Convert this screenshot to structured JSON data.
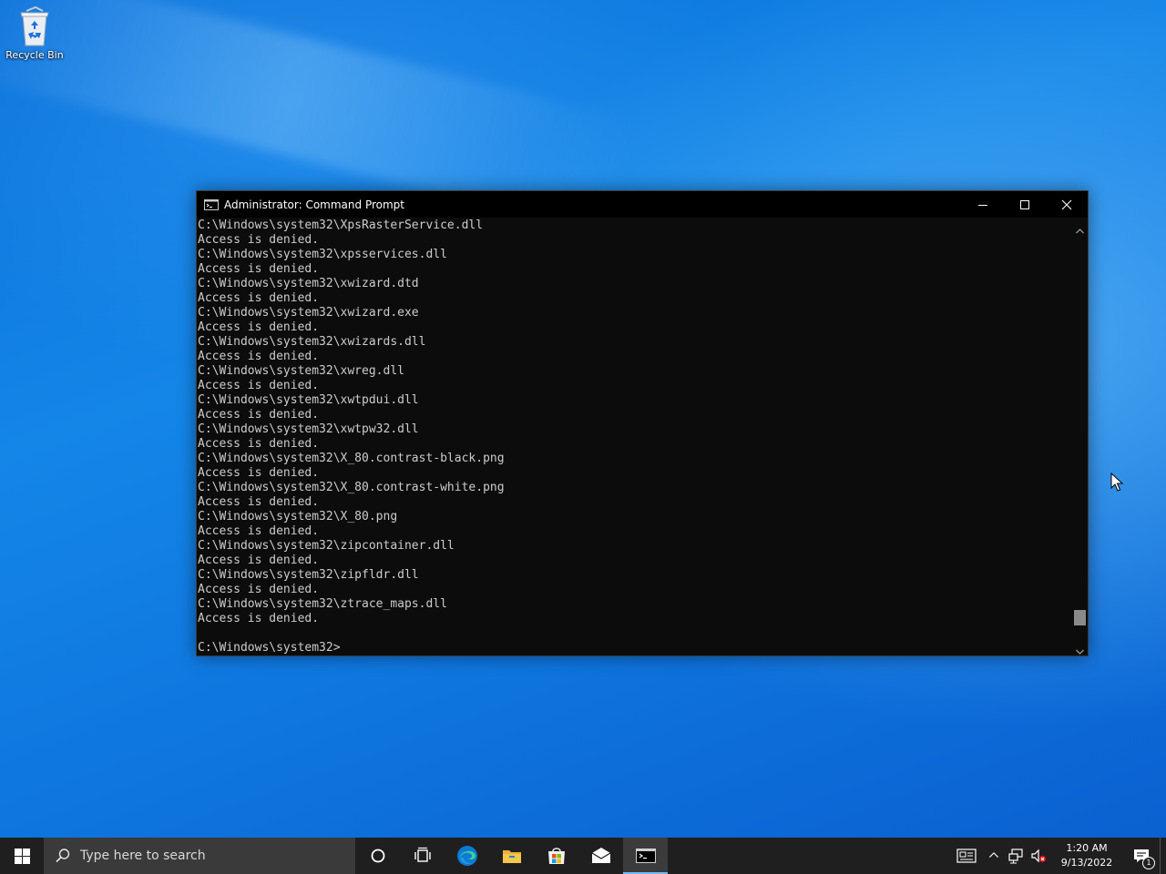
{
  "desktop": {
    "icons": [
      {
        "label": "Recycle Bin",
        "icon": "recycle-bin-icon"
      }
    ]
  },
  "window": {
    "title": "Administrator: Command Prompt",
    "icon": "command-prompt-icon",
    "controls": [
      "minimize-icon",
      "maximize-icon",
      "close-icon"
    ],
    "lines": [
      "C:\\Windows\\system32\\XpsRasterService.dll",
      "Access is denied.",
      "C:\\Windows\\system32\\xpsservices.dll",
      "Access is denied.",
      "C:\\Windows\\system32\\xwizard.dtd",
      "Access is denied.",
      "C:\\Windows\\system32\\xwizard.exe",
      "Access is denied.",
      "C:\\Windows\\system32\\xwizards.dll",
      "Access is denied.",
      "C:\\Windows\\system32\\xwreg.dll",
      "Access is denied.",
      "C:\\Windows\\system32\\xwtpdui.dll",
      "Access is denied.",
      "C:\\Windows\\system32\\xwtpw32.dll",
      "Access is denied.",
      "C:\\Windows\\system32\\X_80.contrast-black.png",
      "Access is denied.",
      "C:\\Windows\\system32\\X_80.contrast-white.png",
      "Access is denied.",
      "C:\\Windows\\system32\\X_80.png",
      "Access is denied.",
      "C:\\Windows\\system32\\zipcontainer.dll",
      "Access is denied.",
      "C:\\Windows\\system32\\zipfldr.dll",
      "Access is denied.",
      "C:\\Windows\\system32\\ztrace_maps.dll",
      "Access is denied.",
      "",
      "C:\\Windows\\system32>"
    ],
    "scroll_position": 0.96
  },
  "taskbar": {
    "search_placeholder": "Type here to search",
    "pinned": [
      {
        "name": "cortana-icon"
      },
      {
        "name": "task-view-icon"
      },
      {
        "name": "edge-icon"
      },
      {
        "name": "file-explorer-icon"
      },
      {
        "name": "microsoft-store-icon"
      },
      {
        "name": "mail-icon"
      },
      {
        "name": "command-prompt-icon",
        "active": true
      }
    ],
    "tray": {
      "icons": [
        "news-icon",
        "chevron-up-icon",
        "network-icon",
        "volume-muted-icon"
      ],
      "time": "1:20 AM",
      "date": "9/13/2022",
      "notification_count": "1"
    }
  },
  "colors": {
    "console_bg": "#0c0c0c",
    "console_text": "#cccccc",
    "taskbar_bg": "#1f1f1f",
    "accent": "#76b9ed"
  }
}
